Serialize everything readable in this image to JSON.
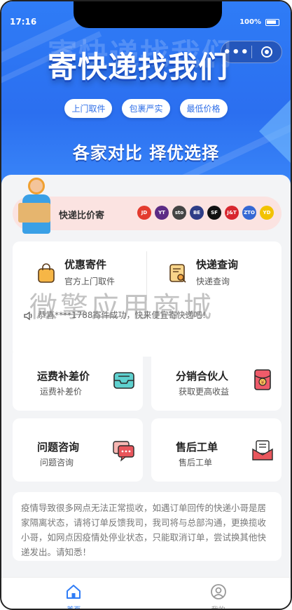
{
  "status": {
    "time": "17:16",
    "battery": "100%"
  },
  "capsule": {
    "menu_label": "•••"
  },
  "hero": {
    "title": "寄快递找我们",
    "tags": [
      "上门取件",
      "包裹严实",
      "最低价格"
    ],
    "subtitle": "各家对比 择优选择"
  },
  "compare": {
    "label": "快递比价寄",
    "logos": [
      {
        "name": "jd-logo",
        "text": "JD",
        "color": "#e33b2e"
      },
      {
        "name": "yunda-logo",
        "text": "YT",
        "color": "#5c2b85"
      },
      {
        "name": "sto-logo",
        "text": "sto",
        "color": "#444444"
      },
      {
        "name": "best-logo",
        "text": "BE",
        "color": "#2e3d87"
      },
      {
        "name": "sf-logo",
        "text": "SF",
        "color": "#111111"
      },
      {
        "name": "jitu-logo",
        "text": "J&T",
        "color": "#d8262e"
      },
      {
        "name": "zto-logo",
        "text": "ZTO",
        "color": "#3568d4"
      },
      {
        "name": "yd-logo",
        "text": "YD",
        "color": "#f2c200"
      }
    ]
  },
  "services": [
    {
      "title": "优惠寄件",
      "sub": "官方上门取件"
    },
    {
      "title": "快递查询",
      "sub": "快递查询"
    }
  ],
  "notice": "恭喜****1788寄件成功，快来便宜寄快递吧！",
  "grid": [
    {
      "title": "运费补差价",
      "sub": "运费补差价"
    },
    {
      "title": "分销合伙人",
      "sub": "获取更高收益"
    },
    {
      "title": "问题咨询",
      "sub": "问题咨询"
    },
    {
      "title": "售后工单",
      "sub": "售后工单"
    }
  ],
  "tips": "疫情导致很多网点无法正常揽收，如遇订单回传的快递小哥是居家隔离状态，请将订单反馈我司，我司将与总部沟通，更换揽收小哥，如网点因疫情处停业状态，只能取消订单，尝试换其他快递发出。请知悉！",
  "watermark": "微擎应用商城",
  "tabbar": [
    {
      "label": "首页",
      "active": true
    },
    {
      "label": "我的",
      "active": false
    }
  ],
  "colors": {
    "primary": "#2f7cf6",
    "active_tab": "#2f7cf6",
    "inactive_tab": "#999999",
    "compare_bg": "#fbe3e1"
  }
}
